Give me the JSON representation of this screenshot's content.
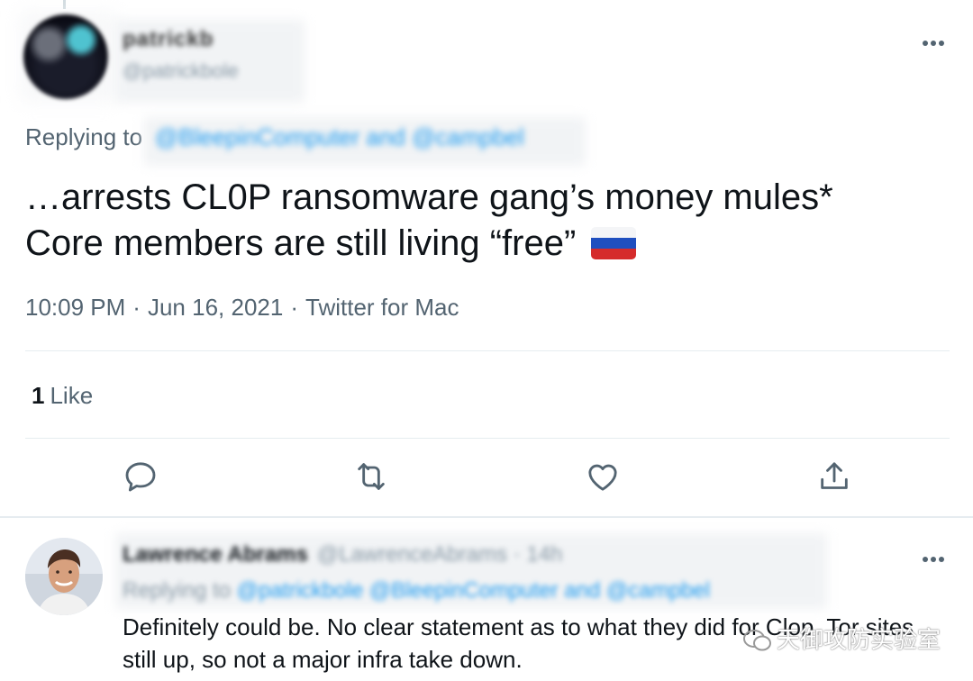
{
  "tweet": {
    "author_name": "patrickb",
    "author_handle": "@patrickbole",
    "replying_label": "Replying to",
    "replying_to": "@BleepinComputer and @campbel",
    "text_line1": "…arrests CL0P ransomware gang’s money mules*",
    "text_line2": "Core members are still living “free”",
    "flag_icon": "russia-flag-icon",
    "time": "10:09 PM",
    "date": "Jun 16, 2021",
    "source": "Twitter for Mac",
    "separator": "·",
    "like_count": "1",
    "like_label": "Like"
  },
  "actions": [
    {
      "name": "reply",
      "icon": "comment-icon"
    },
    {
      "name": "retweet",
      "icon": "retweet-icon"
    },
    {
      "name": "like",
      "icon": "heart-icon"
    },
    {
      "name": "share",
      "icon": "share-icon"
    }
  ],
  "reply": {
    "author_name": "Lawrence Abrams",
    "author_handle": "@LawrenceAbrams · 14h",
    "replying_label": "Replying to",
    "replying_to": "@patrickbole @BleepinComputer and @campbel",
    "text": "Definitely could be. No clear statement as to what they did for Clop. Tor sites still up, so not a major infra take down."
  },
  "watermark": {
    "text": "天御攻防实验室"
  },
  "colors": {
    "secondary_text": "#536471",
    "link": "#1d9bf0",
    "divider": "#e6ecf0"
  }
}
